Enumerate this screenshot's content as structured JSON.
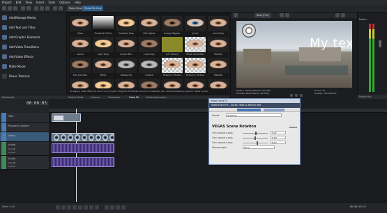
{
  "menu": {
    "items": [
      "Project",
      "Edit",
      "View",
      "Insert",
      "Tools",
      "Options",
      "Help"
    ]
  },
  "toolbar": {
    "tab_make_movie": "Make Movie",
    "tab_show_me_how": "Show Me How"
  },
  "media_panel": {
    "items": [
      {
        "label": "Add/Manage Media",
        "icon": "film-icon"
      },
      {
        "label": "Add Text and Titles",
        "icon": "text-icon"
      },
      {
        "label": "Add Graphic Elements",
        "icon": "shapes-icon"
      },
      {
        "label": "Add Video Transitions",
        "icon": "transition-icon"
      },
      {
        "label": "Add Video Effects",
        "icon": "fx-icon"
      },
      {
        "label": "Make Movie",
        "icon": "movie-icon"
      },
      {
        "label": "Pause Tutorials",
        "icon": "pause-icon"
      }
    ]
  },
  "fx_grid": {
    "rows": [
      [
        "Glow",
        "Gradient Fill Pro",
        "Gradient Map",
        "HSL Adjust",
        "Image Mapper",
        "Invert",
        "Lens Flare"
      ],
      [
        "Levels",
        "Light Rays",
        "Linear Blur",
        "Luma Key",
        "LUT Gallery",
        "Mask Generator",
        "Median"
      ],
      [
        "Min and Max",
        "Mirror",
        "Newsprint",
        "Outline",
        "Picture in Picture",
        "Picture in Picture",
        "Pixelate"
      ],
      [
        "",
        "",
        "",
        "",
        "",
        "",
        ""
      ]
    ],
    "hint": "To apply a video effect to one of your project, drag the thumbnail around to a selected clip, use the sequence view for better visual"
  },
  "panel_tabs": {
    "tabs": [
      "Dashboard",
      "Project Media",
      "Explorer",
      "Transitions",
      "Video FX",
      "Media Generators"
    ]
  },
  "preview": {
    "overlay_text": "My text",
    "mode": "Best (Full)",
    "project_label": "Project:",
    "project_value": "1920x1080x32, 29.970p",
    "preview_label": "Preview:",
    "preview_value": "960x540x32, 29.970p",
    "display_label": "Display:",
    "display_value": "372x209x32",
    "frame_label": "Frame:",
    "frame_value": "95"
  },
  "master": {
    "title": "Master",
    "bus_label": "Master Bus"
  },
  "timeline": {
    "timecode": "00:00:03:21",
    "tracks": [
      {
        "name": "Text",
        "type": "video"
      },
      {
        "name": "Picture in picture",
        "type": "video"
      },
      {
        "name": "Video",
        "type": "video"
      },
      {
        "name": "Audio",
        "type": "audio",
        "vol": "0.0 dB",
        "pan": "Center"
      },
      {
        "name": "Audio",
        "type": "audio",
        "vol": "0.0 dB",
        "pan": "Center"
      }
    ],
    "rate": "Rate: 0.00",
    "end_timecode": "00:00:03:21"
  },
  "dialog": {
    "title": "Video Event FX",
    "subtitle": "Video Event FX: _00161 Titles & Text My text",
    "preset_label": "Preset:",
    "preset_value": "(Default)",
    "heading": "VEGAS Scene Rotation",
    "brand": "VEGAS",
    "rows": [
      {
        "label": "Turn around x-axis:",
        "value": "5.07"
      },
      {
        "label": "Turn around y-axis:",
        "value": "0.00"
      },
      {
        "label": "Turn around z-axis:",
        "value": "8.57"
      },
      {
        "label": "Stereoscopic:",
        "value": "None"
      }
    ]
  }
}
